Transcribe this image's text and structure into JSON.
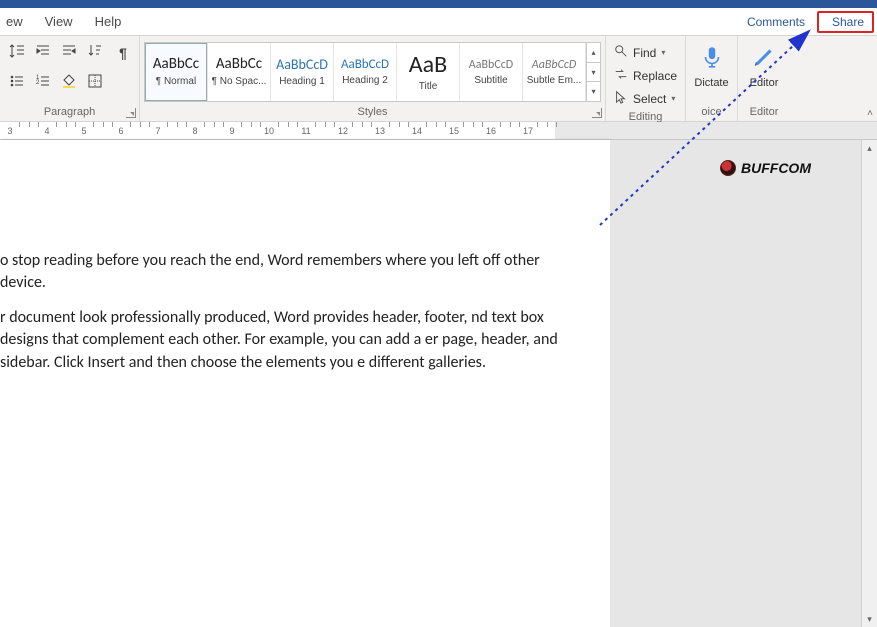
{
  "tabs": {
    "t1": "ew",
    "t2": "View",
    "t3": "Help"
  },
  "topRight": {
    "comments": "Comments",
    "share": "Share"
  },
  "paragraph": {
    "label": "Paragraph"
  },
  "styles": {
    "label": "Styles",
    "items": [
      {
        "name": "¶ Normal",
        "preview": "AaBbCc",
        "size": "15px",
        "color": "#222",
        "selected": true
      },
      {
        "name": "¶ No Spac...",
        "preview": "AaBbCc",
        "size": "15px",
        "color": "#222"
      },
      {
        "name": "Heading 1",
        "preview": "AaBbCcD",
        "size": "14px",
        "color": "#2e74b5"
      },
      {
        "name": "Heading 2",
        "preview": "AaBbCcD",
        "size": "13px",
        "color": "#2e74b5"
      },
      {
        "name": "Title",
        "preview": "AaB",
        "size": "24px",
        "color": "#222"
      },
      {
        "name": "Subtitle",
        "preview": "AaBbCcD",
        "size": "12px",
        "color": "#777"
      },
      {
        "name": "Subtle Em...",
        "preview": "AaBbCcD",
        "size": "12px",
        "color": "#777",
        "italic": true
      }
    ]
  },
  "editing": {
    "label": "Editing",
    "find": "Find",
    "replace": "Replace",
    "select": "Select"
  },
  "voice": {
    "label": "oice",
    "dictate": "Dictate"
  },
  "editor": {
    "label": "Editor",
    "btn": "Editor"
  },
  "ruler": {
    "start": 3,
    "end": 17
  },
  "doc": {
    "p1": "o stop reading before you reach the end, Word remembers where you left off other device.",
    "p2": "r document look professionally produced, Word provides header, footer, nd text box designs that complement each other. For example, you can add a er page, header, and sidebar. Click Insert and then choose the elements you e different galleries."
  },
  "watermark": "BUFFCOM"
}
